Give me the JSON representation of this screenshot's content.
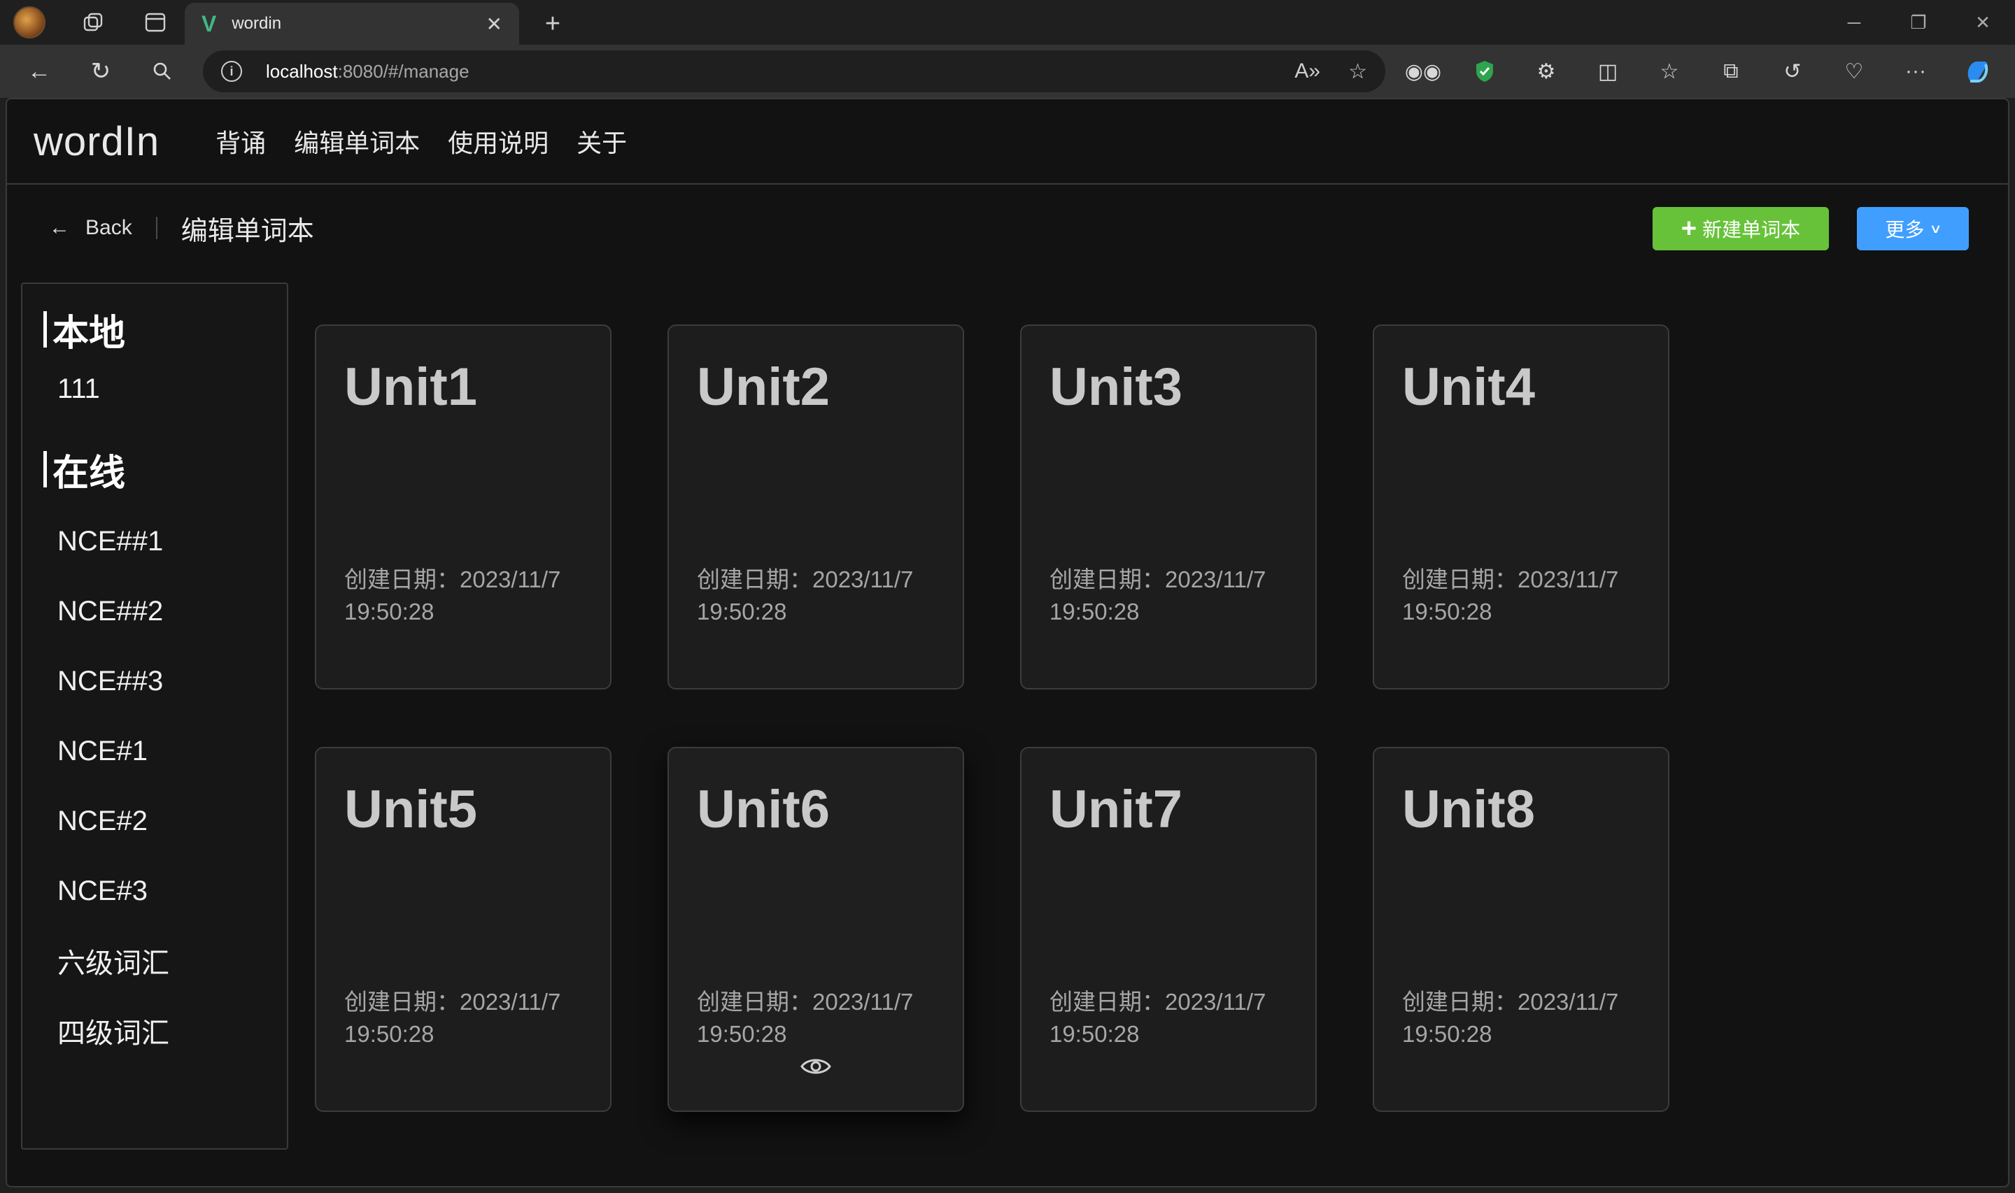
{
  "browser": {
    "tab_title": "wordin",
    "tab_logo": "V",
    "url_host": "localhost",
    "url_path": ":8080/#/manage"
  },
  "app": {
    "brand": "wordIn",
    "menu": [
      "背诵",
      "编辑单词本",
      "使用说明",
      "关于"
    ]
  },
  "subheader": {
    "back_label": "Back",
    "title": "编辑单词本",
    "new_button": "新建单词本",
    "more_button": "更多"
  },
  "sidebar": {
    "local_title": "本地",
    "local_items": [
      "111"
    ],
    "online_title": "在线",
    "online_items": [
      "NCE##1",
      "NCE##2",
      "NCE##3",
      "NCE#1",
      "NCE#2",
      "NCE#3",
      "六级词汇",
      "四级词汇"
    ]
  },
  "cards": [
    {
      "title": "Unit1",
      "date_label": "创建日期：",
      "date": "2023/11/7",
      "time": "19:50:28"
    },
    {
      "title": "Unit2",
      "date_label": "创建日期：",
      "date": "2023/11/7",
      "time": "19:50:28"
    },
    {
      "title": "Unit3",
      "date_label": "创建日期：",
      "date": "2023/11/7",
      "time": "19:50:28"
    },
    {
      "title": "Unit4",
      "date_label": "创建日期：",
      "date": "2023/11/7",
      "time": "19:50:28"
    },
    {
      "title": "Unit5",
      "date_label": "创建日期：",
      "date": "2023/11/7",
      "time": "19:50:28"
    },
    {
      "title": "Unit6",
      "date_label": "创建日期：",
      "date": "2023/11/7",
      "time": "19:50:28",
      "hovered": true
    },
    {
      "title": "Unit7",
      "date_label": "创建日期：",
      "date": "2023/11/7",
      "time": "19:50:28"
    },
    {
      "title": "Unit8",
      "date_label": "创建日期：",
      "date": "2023/11/7",
      "time": "19:50:28"
    }
  ],
  "colors": {
    "new_button": "#67c23a",
    "more_button": "#409eff",
    "vue_logo": "#41b883"
  }
}
